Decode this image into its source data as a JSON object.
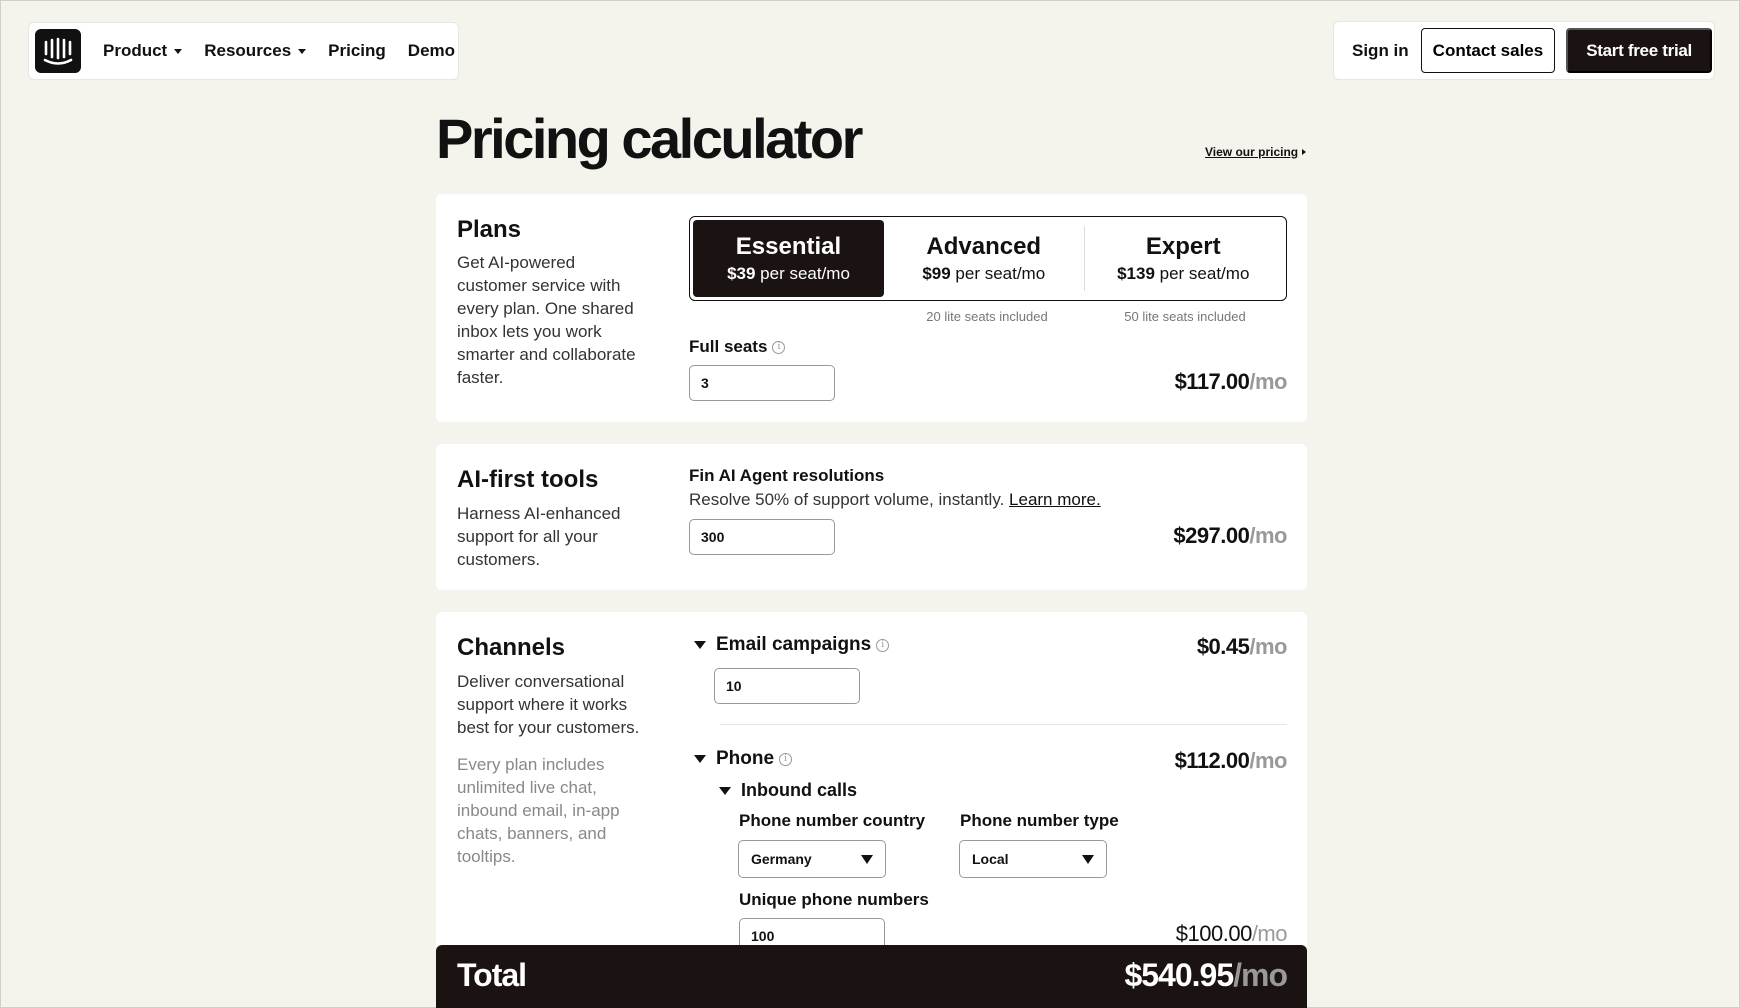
{
  "nav": {
    "logo": "intercom-logo-icon",
    "items": [
      {
        "label": "Product",
        "dropdown": true
      },
      {
        "label": "Resources",
        "dropdown": true
      },
      {
        "label": "Pricing",
        "dropdown": false
      },
      {
        "label": "Demo",
        "dropdown": false
      }
    ],
    "sign_in": "Sign in",
    "contact_sales": "Contact sales",
    "start_trial": "Start free trial"
  },
  "page": {
    "title": "Pricing calculator",
    "view_pricing": "View our pricing"
  },
  "plans": {
    "title": "Plans",
    "description": "Get AI-powered customer service with every plan. One shared inbox lets you work smarter and collaborate faster.",
    "options": [
      {
        "name": "Essential",
        "price": "$39",
        "unit": " per seat/mo",
        "selected": true,
        "note": ""
      },
      {
        "name": "Advanced",
        "price": "$99",
        "unit": " per seat/mo",
        "selected": false,
        "note": "20 lite seats included"
      },
      {
        "name": "Expert",
        "price": "$139",
        "unit": " per seat/mo",
        "selected": false,
        "note": "50 lite seats included"
      }
    ],
    "full_seats_label": "Full seats",
    "full_seats_value": "3",
    "cost": "$117.00",
    "per": "/mo"
  },
  "ai_tools": {
    "title": "AI-first tools",
    "description": "Harness AI-enhanced support for all your customers.",
    "fin_label": "Fin AI Agent resolutions",
    "fin_desc": "Resolve 50% of support volume, instantly.",
    "learn_more": "Learn more.",
    "fin_value": "300",
    "cost": "$297.00",
    "per": "/mo"
  },
  "channels": {
    "title": "Channels",
    "description": "Deliver conversational support where it works best for your customers.",
    "note": "Every plan includes unlimited live chat, inbound email, in-app chats, banners, and tooltips.",
    "email": {
      "label": "Email campaigns",
      "value": "10",
      "cost": "$0.45",
      "per": "/mo"
    },
    "phone": {
      "label": "Phone",
      "cost": "$112.00",
      "per": "/mo",
      "inbound_label": "Inbound calls",
      "country_label": "Phone number country",
      "country_value": "Germany",
      "type_label": "Phone number type",
      "type_value": "Local",
      "unique_label": "Unique phone numbers",
      "unique_value": "100",
      "unique_cost": "$100.00",
      "unique_per": "/mo"
    }
  },
  "total": {
    "label": "Total",
    "value": "$540.95",
    "per": "/mo"
  }
}
